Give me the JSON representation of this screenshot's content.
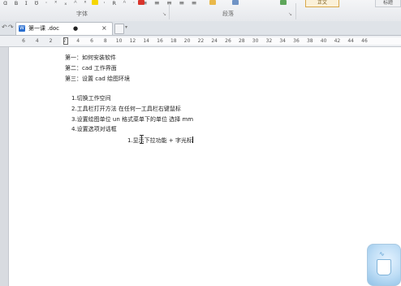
{
  "ribbon": {
    "group_font": "字体",
    "group_paragraph": "段落",
    "button_1": "正文",
    "button_2": "标题"
  },
  "tabs": {
    "doc_title": "第一课 .doc",
    "modified_dot": "●",
    "close": "×"
  },
  "ruler": {
    "ticks": [
      "6",
      "4",
      "2",
      "2",
      "4",
      "6",
      "8",
      "10",
      "12",
      "14",
      "16",
      "18",
      "20",
      "22",
      "24",
      "26",
      "28",
      "30",
      "32",
      "34",
      "36",
      "38",
      "40",
      "42",
      "44",
      "46"
    ]
  },
  "document": {
    "lines": [
      "第一：如何安装软件",
      "第二：cad 工作界面",
      "第三：设置 cad 绘图环境",
      "1.切换工作空间",
      "2.工具栏打开方法   在任何一工具栏右键鼠标",
      "3.设置绘图单位    un  格式菜单下的单位    选择 mm",
      "4.设置选项对话框",
      "1.显示下拉功能 + 字光标"
    ]
  },
  "icons": {
    "undo": "undo-icon",
    "redo": "redo-icon",
    "word_doc": "word-doc-icon",
    "new_tab": "new-tab-icon",
    "assistant": "assistant-widget-icon"
  }
}
